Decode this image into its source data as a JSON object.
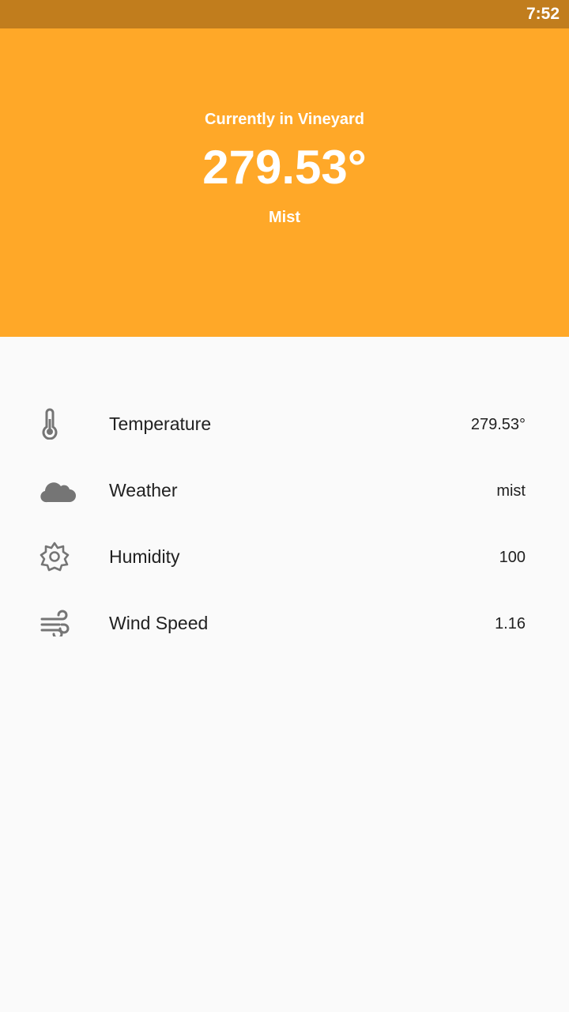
{
  "status_bar": {
    "time": "7:52"
  },
  "header": {
    "location": "Currently in Vineyard",
    "temperature": "279.53°",
    "description": "Mist"
  },
  "details": [
    {
      "icon": "thermometer-icon",
      "label": "Temperature",
      "value": "279.53°"
    },
    {
      "icon": "cloud-icon",
      "label": "Weather",
      "value": "mist"
    },
    {
      "icon": "gear-icon",
      "label": "Humidity",
      "value": "100"
    },
    {
      "icon": "wind-icon",
      "label": "Wind Speed",
      "value": "1.16"
    }
  ],
  "colors": {
    "status_bar": "#c17d1d",
    "header": "#ffa828",
    "background": "#fafafa",
    "icon": "#757575"
  }
}
